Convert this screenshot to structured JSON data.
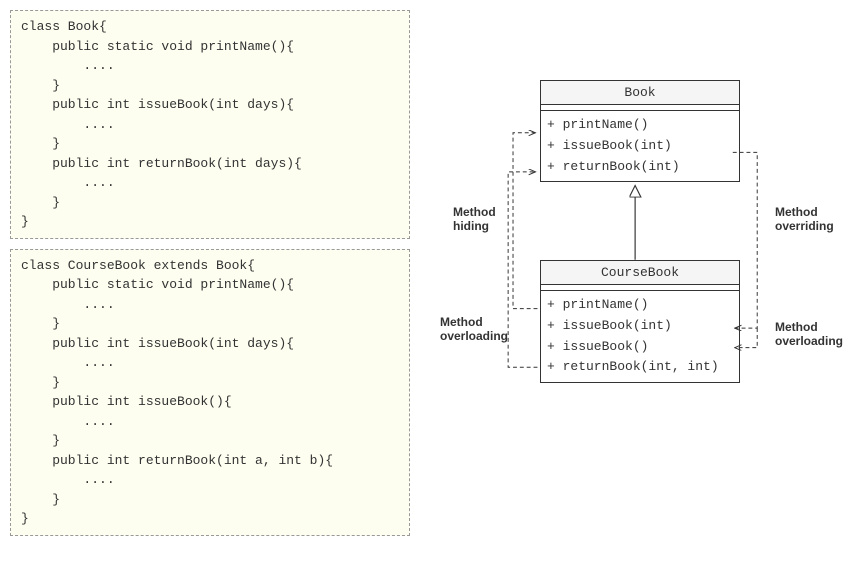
{
  "code": {
    "book": "class Book{\n    public static void printName(){\n        ....\n    }\n    public int issueBook(int days){\n        ....\n    }\n    public int returnBook(int days){\n        ....\n    }\n}",
    "coursebook": "class CourseBook extends Book{\n    public static void printName(){\n        ....\n    }\n    public int issueBook(int days){\n        ....\n    }\n    public int issueBook(){\n        ....\n    }\n    public int returnBook(int a, int b){\n        ....\n    }\n}"
  },
  "uml": {
    "book": {
      "name": "Book",
      "methods": [
        "+ printName()",
        "+ issueBook(int)",
        "+ returnBook(int)"
      ]
    },
    "coursebook": {
      "name": "CourseBook",
      "methods": [
        "+ printName()",
        "+ issueBook(int)",
        "+ issueBook()",
        "+ returnBook(int, int)"
      ]
    }
  },
  "labels": {
    "hiding": "Method\nhiding",
    "overriding": "Method\noverriding",
    "overloading_left": "Method\noverloading",
    "overloading_right": "Method\noverloading"
  }
}
